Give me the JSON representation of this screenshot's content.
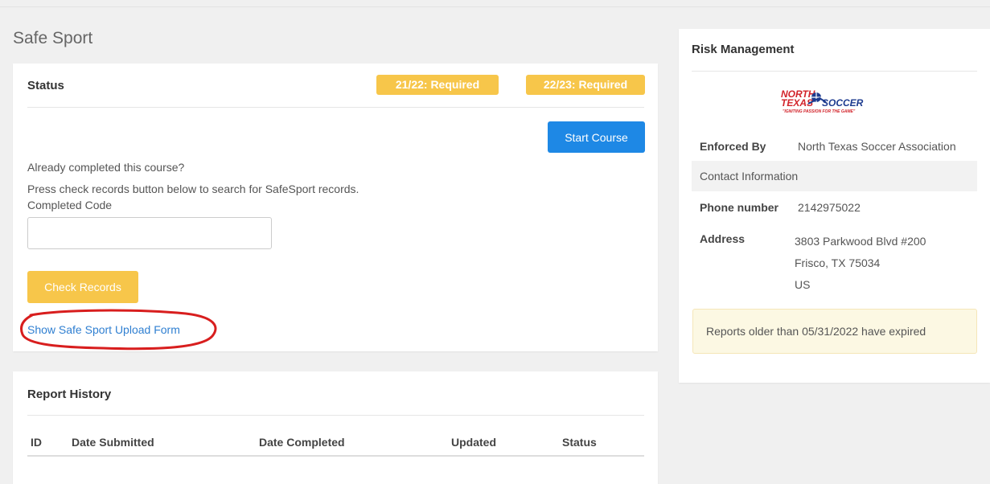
{
  "page": {
    "title": "Safe Sport"
  },
  "status": {
    "title": "Status",
    "badges": [
      "21/22: Required",
      "22/23: Required"
    ],
    "start_course_label": "Start Course",
    "completed_question": "Already completed this course?",
    "instruction": "Press check records button below to search for SafeSport records.",
    "completed_code_label": "Completed Code",
    "completed_code_value": "",
    "check_records_label": "Check Records",
    "upload_link": "Show Safe Sport Upload Form"
  },
  "report_history": {
    "title": "Report History",
    "columns": [
      "ID",
      "Date Submitted",
      "Date Completed",
      "Updated",
      "Status"
    ],
    "rows": []
  },
  "risk": {
    "title": "Risk Management",
    "logo": {
      "line1": "NORTH",
      "line2": "TEXAS",
      "line3": "SOCCER",
      "tagline": "\"IGNITING PASSION FOR THE GAME\""
    },
    "enforced_by_label": "Enforced By",
    "enforced_by_value": "North Texas Soccer Association",
    "contact_header": "Contact Information",
    "phone_label": "Phone number",
    "phone_value": "2142975022",
    "address_label": "Address",
    "address_lines": [
      "3803 Parkwood Blvd #200",
      "Frisco, TX 75034",
      "US"
    ],
    "alert": "Reports older than 05/31/2022 have expired"
  },
  "colors": {
    "primary": "#1e88e5",
    "warning": "#f7c64a",
    "link": "#2f7fd1",
    "annotation": "#d81e1e",
    "logo_red": "#d2232a",
    "logo_blue": "#1d3b8f"
  }
}
